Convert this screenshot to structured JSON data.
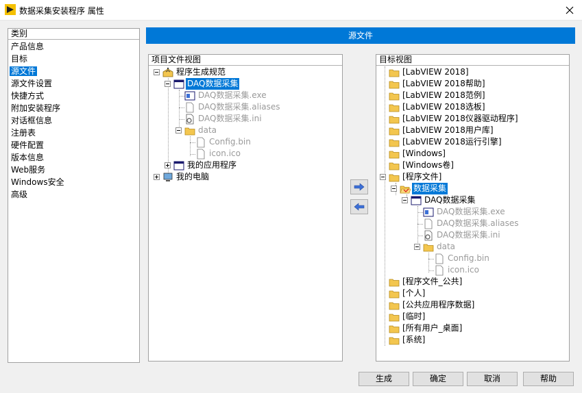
{
  "window": {
    "title": "数据采集安装程序 属性"
  },
  "categories": {
    "header": "类别",
    "items": [
      "产品信息",
      "目标",
      "源文件",
      "源文件设置",
      "快捷方式",
      "附加安装程序",
      "对话框信息",
      "注册表",
      "硬件配置",
      "版本信息",
      "Web服务",
      "Windows安全",
      "高级"
    ],
    "selected": "源文件"
  },
  "banner": {
    "title": "源文件"
  },
  "project_view": {
    "header": "项目文件视图",
    "items": {
      "build_spec": "程序生成规范",
      "daq": "DAQ数据采集",
      "exe": "DAQ数据采集.exe",
      "aliases": "DAQ数据采集.aliases",
      "ini": "DAQ数据采集.ini",
      "data": "data",
      "config": "Config.bin",
      "icon": "icon.ico",
      "my_app": "我的应用程序",
      "my_computer": "我的电脑"
    }
  },
  "target_view": {
    "header": "目标视图",
    "folders_top": [
      "[LabVIEW 2018]",
      "[LabVIEW 2018帮助]",
      "[LabVIEW 2018范例]",
      "[LabVIEW 2018选板]",
      "[LabVIEW 2018仪器驱动程序]",
      "[LabVIEW 2018用户库]",
      "[LabVIEW 2018运行引擎]",
      "[Windows]",
      "[Windows卷]",
      "[程序文件]"
    ],
    "program_files": {
      "folder": "数据采集",
      "daq": "DAQ数据采集",
      "exe": "DAQ数据采集.exe",
      "aliases": "DAQ数据采集.aliases",
      "ini": "DAQ数据采集.ini",
      "data": "data",
      "config": "Config.bin",
      "icon": "icon.ico"
    },
    "folders_bottom": [
      "[程序文件_公共]",
      "[个人]",
      "[公共应用程序数据]",
      "[临时]",
      "[所有用户_桌面]",
      "[系统]"
    ]
  },
  "buttons": {
    "build": "生成",
    "ok": "确定",
    "cancel": "取消",
    "help": "帮助"
  },
  "colors": {
    "accent": "#0078d7",
    "folder": "#f3c64f",
    "arrow": "#3c6fd6"
  }
}
